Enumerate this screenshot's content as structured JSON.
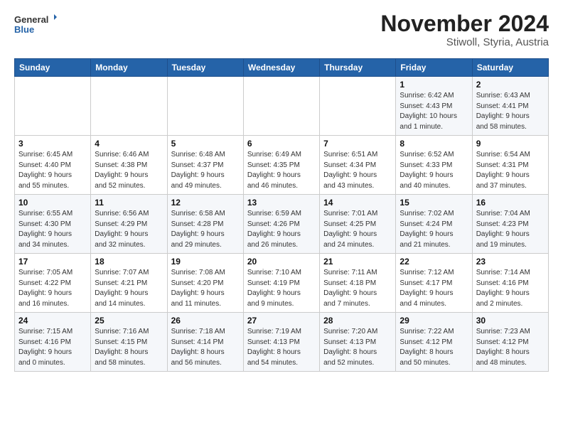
{
  "logo": {
    "line1": "General",
    "line2": "Blue"
  },
  "title": "November 2024",
  "subtitle": "Stiwoll, Styria, Austria",
  "days_of_week": [
    "Sunday",
    "Monday",
    "Tuesday",
    "Wednesday",
    "Thursday",
    "Friday",
    "Saturday"
  ],
  "weeks": [
    [
      {
        "day": "",
        "info": ""
      },
      {
        "day": "",
        "info": ""
      },
      {
        "day": "",
        "info": ""
      },
      {
        "day": "",
        "info": ""
      },
      {
        "day": "",
        "info": ""
      },
      {
        "day": "1",
        "info": "Sunrise: 6:42 AM\nSunset: 4:43 PM\nDaylight: 10 hours\nand 1 minute."
      },
      {
        "day": "2",
        "info": "Sunrise: 6:43 AM\nSunset: 4:41 PM\nDaylight: 9 hours\nand 58 minutes."
      }
    ],
    [
      {
        "day": "3",
        "info": "Sunrise: 6:45 AM\nSunset: 4:40 PM\nDaylight: 9 hours\nand 55 minutes."
      },
      {
        "day": "4",
        "info": "Sunrise: 6:46 AM\nSunset: 4:38 PM\nDaylight: 9 hours\nand 52 minutes."
      },
      {
        "day": "5",
        "info": "Sunrise: 6:48 AM\nSunset: 4:37 PM\nDaylight: 9 hours\nand 49 minutes."
      },
      {
        "day": "6",
        "info": "Sunrise: 6:49 AM\nSunset: 4:35 PM\nDaylight: 9 hours\nand 46 minutes."
      },
      {
        "day": "7",
        "info": "Sunrise: 6:51 AM\nSunset: 4:34 PM\nDaylight: 9 hours\nand 43 minutes."
      },
      {
        "day": "8",
        "info": "Sunrise: 6:52 AM\nSunset: 4:33 PM\nDaylight: 9 hours\nand 40 minutes."
      },
      {
        "day": "9",
        "info": "Sunrise: 6:54 AM\nSunset: 4:31 PM\nDaylight: 9 hours\nand 37 minutes."
      }
    ],
    [
      {
        "day": "10",
        "info": "Sunrise: 6:55 AM\nSunset: 4:30 PM\nDaylight: 9 hours\nand 34 minutes."
      },
      {
        "day": "11",
        "info": "Sunrise: 6:56 AM\nSunset: 4:29 PM\nDaylight: 9 hours\nand 32 minutes."
      },
      {
        "day": "12",
        "info": "Sunrise: 6:58 AM\nSunset: 4:28 PM\nDaylight: 9 hours\nand 29 minutes."
      },
      {
        "day": "13",
        "info": "Sunrise: 6:59 AM\nSunset: 4:26 PM\nDaylight: 9 hours\nand 26 minutes."
      },
      {
        "day": "14",
        "info": "Sunrise: 7:01 AM\nSunset: 4:25 PM\nDaylight: 9 hours\nand 24 minutes."
      },
      {
        "day": "15",
        "info": "Sunrise: 7:02 AM\nSunset: 4:24 PM\nDaylight: 9 hours\nand 21 minutes."
      },
      {
        "day": "16",
        "info": "Sunrise: 7:04 AM\nSunset: 4:23 PM\nDaylight: 9 hours\nand 19 minutes."
      }
    ],
    [
      {
        "day": "17",
        "info": "Sunrise: 7:05 AM\nSunset: 4:22 PM\nDaylight: 9 hours\nand 16 minutes."
      },
      {
        "day": "18",
        "info": "Sunrise: 7:07 AM\nSunset: 4:21 PM\nDaylight: 9 hours\nand 14 minutes."
      },
      {
        "day": "19",
        "info": "Sunrise: 7:08 AM\nSunset: 4:20 PM\nDaylight: 9 hours\nand 11 minutes."
      },
      {
        "day": "20",
        "info": "Sunrise: 7:10 AM\nSunset: 4:19 PM\nDaylight: 9 hours\nand 9 minutes."
      },
      {
        "day": "21",
        "info": "Sunrise: 7:11 AM\nSunset: 4:18 PM\nDaylight: 9 hours\nand 7 minutes."
      },
      {
        "day": "22",
        "info": "Sunrise: 7:12 AM\nSunset: 4:17 PM\nDaylight: 9 hours\nand 4 minutes."
      },
      {
        "day": "23",
        "info": "Sunrise: 7:14 AM\nSunset: 4:16 PM\nDaylight: 9 hours\nand 2 minutes."
      }
    ],
    [
      {
        "day": "24",
        "info": "Sunrise: 7:15 AM\nSunset: 4:16 PM\nDaylight: 9 hours\nand 0 minutes."
      },
      {
        "day": "25",
        "info": "Sunrise: 7:16 AM\nSunset: 4:15 PM\nDaylight: 8 hours\nand 58 minutes."
      },
      {
        "day": "26",
        "info": "Sunrise: 7:18 AM\nSunset: 4:14 PM\nDaylight: 8 hours\nand 56 minutes."
      },
      {
        "day": "27",
        "info": "Sunrise: 7:19 AM\nSunset: 4:13 PM\nDaylight: 8 hours\nand 54 minutes."
      },
      {
        "day": "28",
        "info": "Sunrise: 7:20 AM\nSunset: 4:13 PM\nDaylight: 8 hours\nand 52 minutes."
      },
      {
        "day": "29",
        "info": "Sunrise: 7:22 AM\nSunset: 4:12 PM\nDaylight: 8 hours\nand 50 minutes."
      },
      {
        "day": "30",
        "info": "Sunrise: 7:23 AM\nSunset: 4:12 PM\nDaylight: 8 hours\nand 48 minutes."
      }
    ]
  ]
}
